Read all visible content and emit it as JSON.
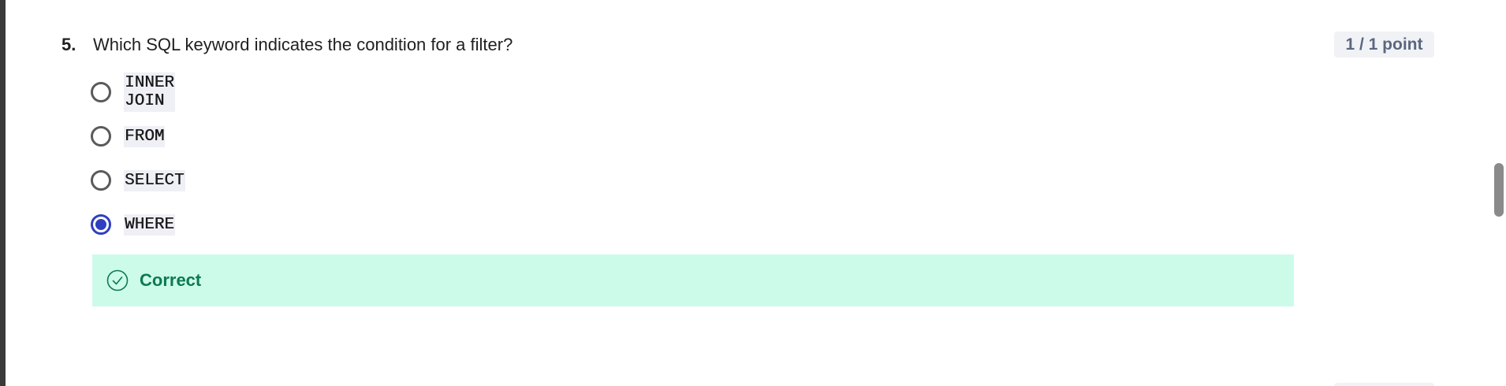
{
  "question": {
    "number": "5.",
    "text": "Which SQL keyword indicates the condition for a filter?",
    "points": "1 / 1 point"
  },
  "options": [
    {
      "label": "INNER JOIN",
      "selected": false
    },
    {
      "label": "FROM",
      "selected": false
    },
    {
      "label": "SELECT",
      "selected": false
    },
    {
      "label": "WHERE",
      "selected": true
    }
  ],
  "feedback": {
    "status": "Correct",
    "icon": "check-circle-icon",
    "color": "#0c7a52",
    "background": "#ccfbea"
  },
  "colors": {
    "accent": "#2e3fbf"
  }
}
